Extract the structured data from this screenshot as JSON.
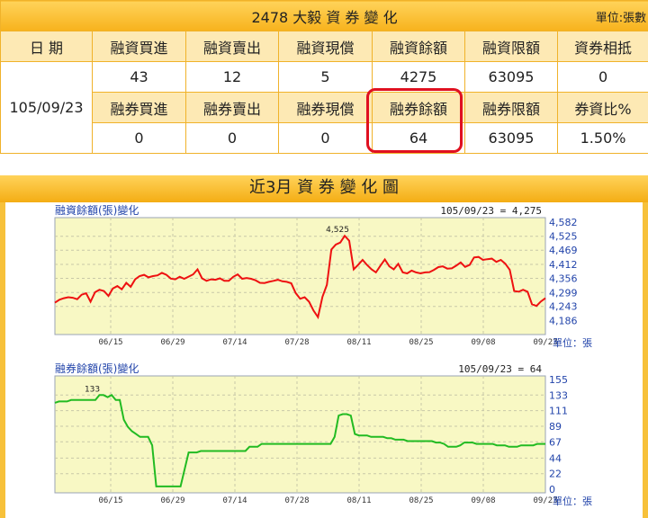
{
  "summary": {
    "title": "2478 大毅 資 券 變 化",
    "unit": "單位:張數",
    "date_label": "日 期",
    "date": "105/09/23",
    "margin_headers": [
      "融資買進",
      "融資賣出",
      "融資現償",
      "融資餘額",
      "融資限額",
      "資券相抵"
    ],
    "margin_values": [
      "43",
      "12",
      "5",
      "4275",
      "63095",
      "0"
    ],
    "short_headers": [
      "融券買進",
      "融券賣出",
      "融券現償",
      "融券餘額",
      "融券限額",
      "券資比%"
    ],
    "short_values": [
      "0",
      "0",
      "0",
      "64",
      "63095",
      "1.50%"
    ],
    "highlight_color": "#e01020"
  },
  "chart_section": {
    "title": "近3月 資 券 變 化 圖"
  },
  "chart_data": [
    {
      "type": "line",
      "title": "融資餘額(張)變化",
      "latest_label": "105/09/23 = 4,275",
      "peak_label": "4,525",
      "unit_label": "單位：張",
      "color": "#ee1111",
      "ylim": [
        4130,
        4600
      ],
      "yticks": [
        "4,582",
        "4,525",
        "4,469",
        "4,412",
        "4,356",
        "4,299",
        "4,243",
        "4,186"
      ],
      "ytick_values": [
        4582,
        4525,
        4469,
        4412,
        4356,
        4299,
        4243,
        4186
      ],
      "xticks": [
        "06/15",
        "06/29",
        "07/14",
        "07/28",
        "08/11",
        "08/25",
        "09/08",
        "09/23"
      ],
      "series": [
        {
          "values": [
            4258,
            4270,
            4276,
            4280,
            4278,
            4272,
            4290,
            4296,
            4262,
            4300,
            4310,
            4305,
            4285,
            4315,
            4325,
            4312,
            4338,
            4322,
            4352,
            4365,
            4370,
            4360,
            4365,
            4368,
            4378,
            4370,
            4355,
            4352,
            4362,
            4354,
            4363,
            4372,
            4392,
            4356,
            4346,
            4352,
            4350,
            4356,
            4346,
            4346,
            4362,
            4372,
            4354,
            4357,
            4354,
            4348,
            4338,
            4337,
            4342,
            4346,
            4350,
            4344,
            4342,
            4336,
            4297,
            4274,
            4280,
            4262,
            4226,
            4200,
            4282,
            4330,
            4472,
            4492,
            4500,
            4527,
            4507,
            4392,
            4410,
            4430,
            4410,
            4392,
            4380,
            4407,
            4432,
            4404,
            4392,
            4414,
            4380,
            4376,
            4387,
            4380,
            4376,
            4380,
            4381,
            4390,
            4401,
            4404,
            4395,
            4396,
            4407,
            4420,
            4402,
            4410,
            4440,
            4442,
            4430,
            4433,
            4435,
            4422,
            4430,
            4415,
            4390,
            4305,
            4302,
            4310,
            4302,
            4252,
            4245,
            4263,
            4276
          ]
        }
      ]
    },
    {
      "type": "line",
      "title": "融券餘額(張)變化",
      "latest_label": "105/09/23 = 64",
      "peak_label": "133",
      "unit_label": "單位：張",
      "color": "#22bb22",
      "ylim": [
        -5,
        160
      ],
      "yticks": [
        "155",
        "133",
        "111",
        "89",
        "67",
        "44",
        "22",
        "0"
      ],
      "ytick_values": [
        155,
        133,
        111,
        89,
        67,
        44,
        22,
        0
      ],
      "xticks": [
        "06/15",
        "06/29",
        "07/14",
        "07/28",
        "08/11",
        "08/25",
        "09/08",
        "09/23"
      ],
      "series": [
        {
          "values": [
            122,
            124,
            124,
            124,
            126,
            126,
            126,
            126,
            126,
            126,
            126,
            133,
            133,
            130,
            133,
            126,
            126,
            98,
            88,
            82,
            78,
            74,
            74,
            74,
            62,
            4,
            4,
            4,
            4,
            4,
            4,
            4,
            28,
            52,
            52,
            52,
            54,
            54,
            54,
            54,
            54,
            54,
            54,
            54,
            54,
            54,
            54,
            54,
            60,
            60,
            60,
            64,
            64,
            64,
            64,
            64,
            64,
            64,
            64,
            64,
            64,
            64,
            64,
            64,
            64,
            64,
            64,
            64,
            64,
            74,
            104,
            106,
            106,
            104,
            78,
            76,
            76,
            76,
            74,
            74,
            74,
            74,
            72,
            72,
            70,
            70,
            70,
            68,
            68,
            68,
            68,
            68,
            68,
            68,
            66,
            66,
            64,
            60,
            60,
            60,
            62,
            66,
            66,
            66,
            64,
            64,
            64,
            64,
            64,
            62,
            62,
            62,
            60,
            60,
            60,
            62,
            62,
            62,
            62,
            64,
            64,
            64
          ]
        }
      ]
    }
  ]
}
